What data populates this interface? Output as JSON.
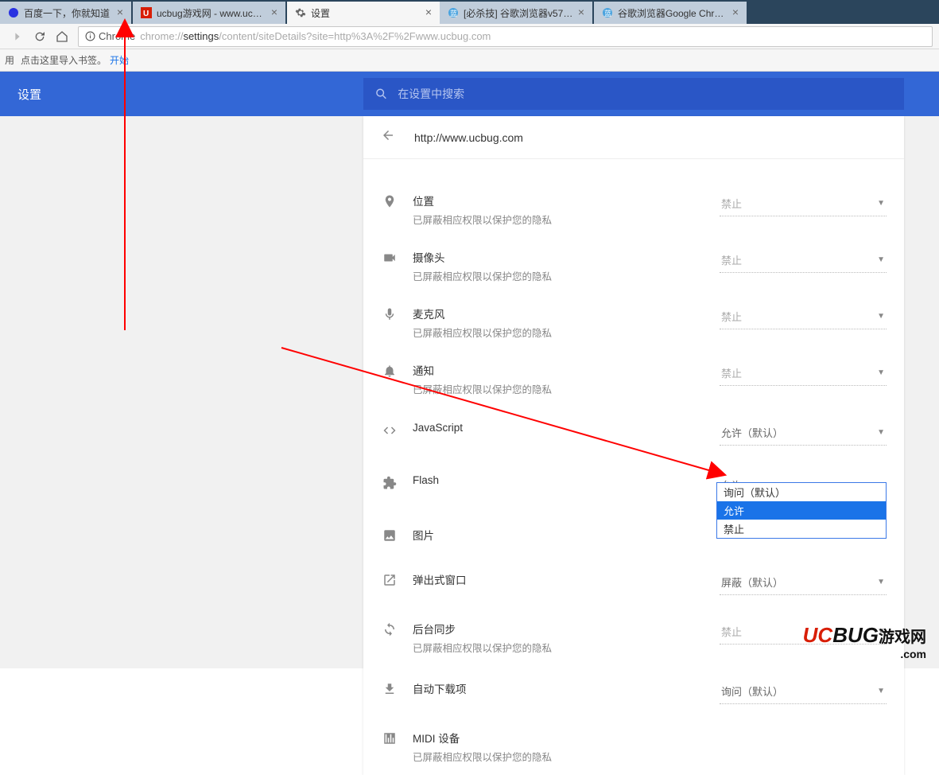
{
  "tabs": [
    {
      "title": "百度一下，你就知道",
      "favicon": "baidu"
    },
    {
      "title": "ucbug游戏网 - www.ucb…",
      "favicon": "ucbug"
    },
    {
      "title": "设置",
      "favicon": "gear",
      "active": true
    },
    {
      "title": "[必杀技] 谷歌浏览器v57…",
      "favicon": "lan"
    },
    {
      "title": "谷歌浏览器Google Chro…",
      "favicon": "lan"
    }
  ],
  "url": {
    "secure_label": "Chrome",
    "prefix": "chrome://",
    "bold": "settings",
    "suffix": "/content/siteDetails?site=http%3A%2F%2Fwww.ucbug.com"
  },
  "bookmark_hint_prefix": "用",
  "bookmark_hint": "点击这里导入书签。",
  "bookmark_start": "开始",
  "settings_title": "设置",
  "search_placeholder": "在设置中搜索",
  "site_url": "http://www.ucbug.com",
  "blocked_text": "已屏蔽相应权限以保护您的隐私",
  "rows": [
    {
      "icon": "location",
      "label": "位置",
      "sub": true,
      "value": "禁止",
      "disabled": true
    },
    {
      "icon": "camera",
      "label": "摄像头",
      "sub": true,
      "value": "禁止",
      "disabled": true
    },
    {
      "icon": "mic",
      "label": "麦克风",
      "sub": true,
      "value": "禁止",
      "disabled": true
    },
    {
      "icon": "bell",
      "label": "通知",
      "sub": true,
      "value": "禁止",
      "disabled": true
    },
    {
      "icon": "code",
      "label": "JavaScript",
      "sub": false,
      "value": "允许（默认）"
    },
    {
      "icon": "puzzle",
      "label": "Flash",
      "sub": false,
      "value": "允许",
      "open": true
    },
    {
      "icon": "image",
      "label": "图片",
      "sub": false,
      "value": ""
    },
    {
      "icon": "popup",
      "label": "弹出式窗口",
      "sub": false,
      "value": "屏蔽（默认）"
    },
    {
      "icon": "sync",
      "label": "后台同步",
      "sub": true,
      "value": "禁止",
      "disabled": true
    },
    {
      "icon": "download",
      "label": "自动下载项",
      "sub": false,
      "value": "询问（默认）"
    },
    {
      "icon": "midi",
      "label": "MIDI 设备",
      "sub": true,
      "value": "",
      "disabled": true
    }
  ],
  "flash_menu": {
    "options": [
      "询问（默认）",
      "允许",
      "禁止"
    ],
    "selected": 1
  },
  "watermark": {
    "brand": "UCBUG",
    "cn": "游戏网",
    "com": ".com"
  }
}
